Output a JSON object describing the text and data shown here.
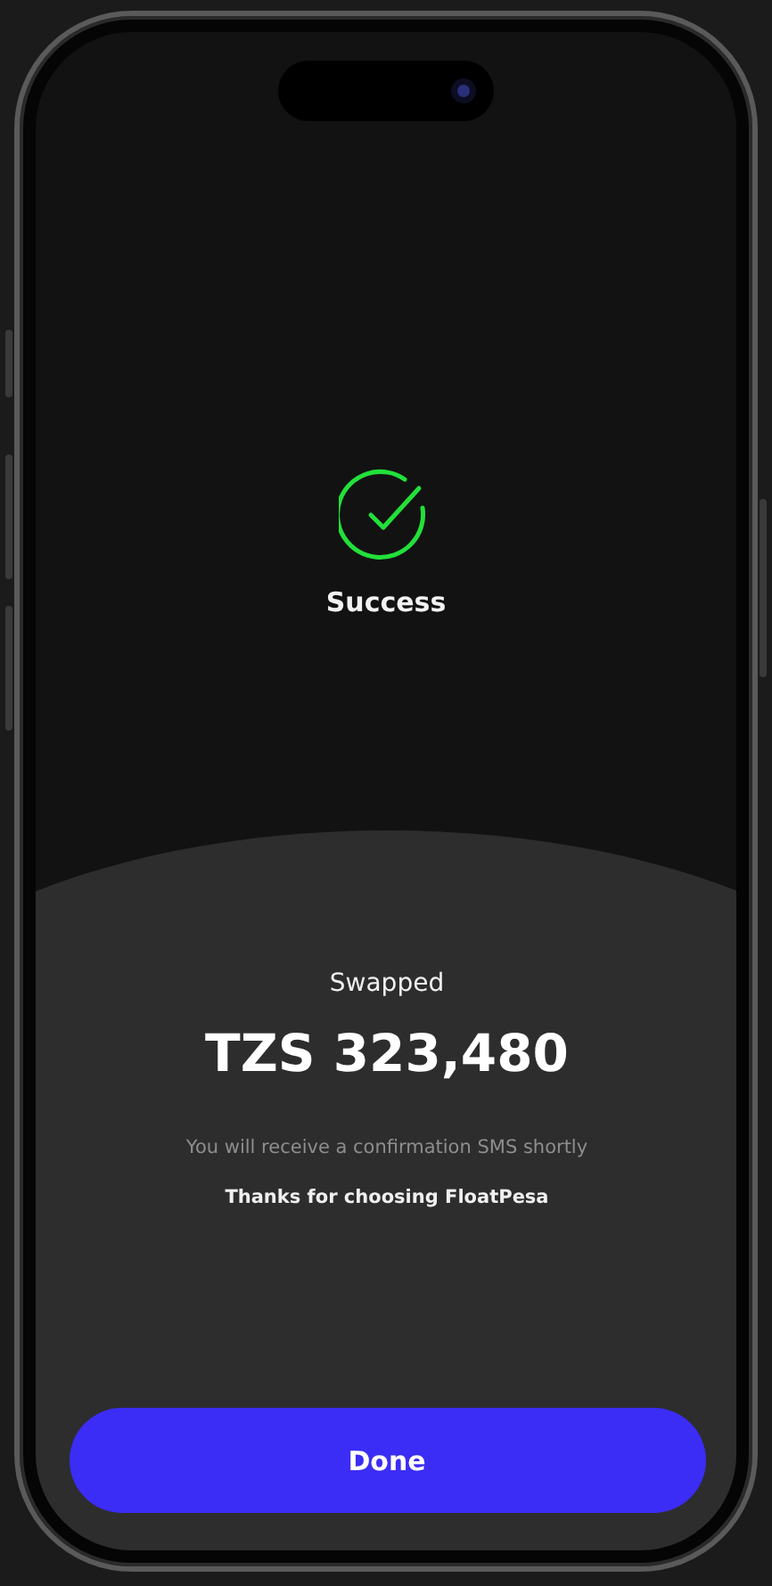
{
  "status": {
    "title": "Success"
  },
  "summary": {
    "label": "Swapped",
    "amount": "TZS 323,480",
    "note": "You will receive a confirmation SMS shortly",
    "thanks": "Thanks for choosing FloatPesa"
  },
  "button": {
    "label": "Done"
  }
}
